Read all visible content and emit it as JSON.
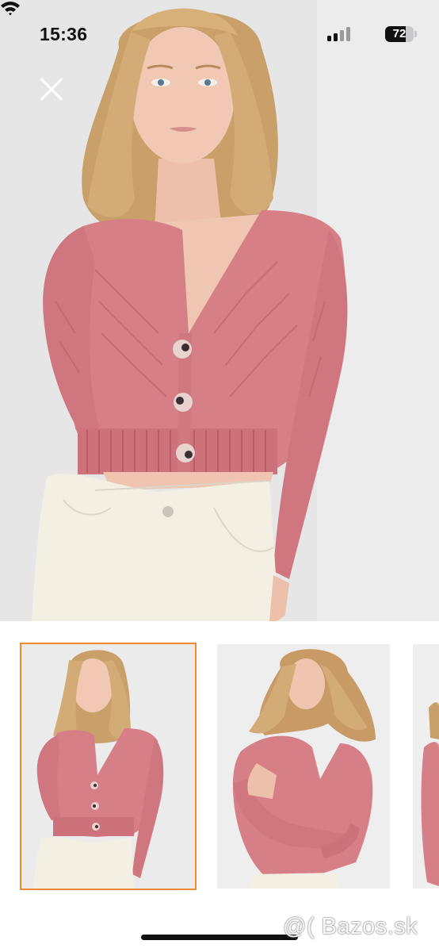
{
  "status_bar": {
    "time": "15:36",
    "battery_level": "72"
  },
  "hero": {
    "close_icon": "close-icon",
    "photo_subject": "model-in-pink-knit-cardigan"
  },
  "gallery": {
    "selected_index": 0,
    "accent_color": "#f08a2c",
    "thumbnails": [
      {
        "state": "selected"
      },
      {
        "state": "default"
      },
      {
        "state": "partial"
      }
    ]
  },
  "watermark": "@( Bazos.sk",
  "colors": {
    "sweater": "#d97f86",
    "background": "#e8e8e9",
    "selection": "#f08a2c"
  }
}
